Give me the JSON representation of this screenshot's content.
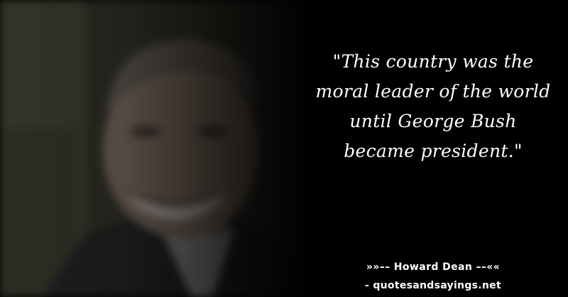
{
  "quote": {
    "text": "\"This country was the moral leader of the world until George Bush became president.\""
  },
  "attribution": {
    "author_line": "»»–– Howard Dean ––««",
    "source_line": "- quotesandsayings.net"
  },
  "colors": {
    "background": "#000000",
    "text": "#ffffff"
  }
}
